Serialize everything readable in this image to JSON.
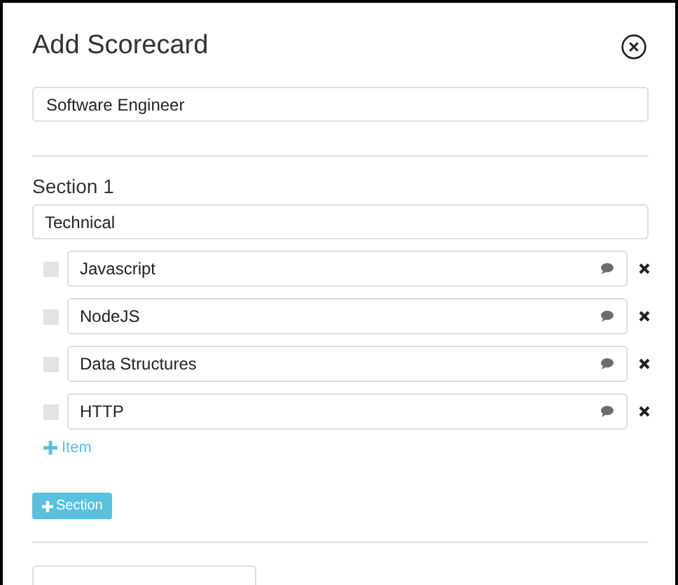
{
  "dialog": {
    "title": "Add Scorecard",
    "name_field": {
      "value": "Software Engineer"
    }
  },
  "sections": [
    {
      "label": "Section 1",
      "name_field": {
        "value": "Technical"
      },
      "items": [
        {
          "value": "Javascript",
          "checked": false
        },
        {
          "value": "NodeJS",
          "checked": false
        },
        {
          "value": "Data Structures",
          "checked": false
        },
        {
          "value": "HTTP",
          "checked": false
        }
      ],
      "add_item": "Item"
    }
  ],
  "add_section": "Section"
}
